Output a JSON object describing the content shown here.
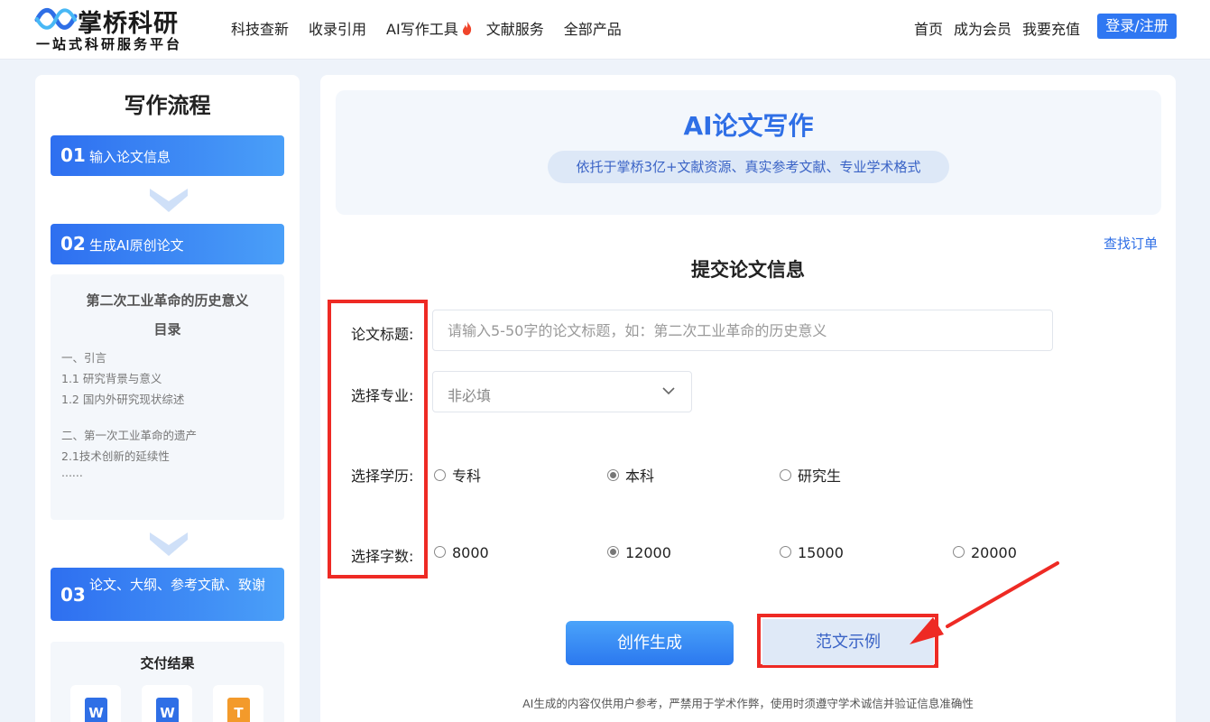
{
  "header": {
    "logo_title": "掌桥科研",
    "logo_subtitle": "一站式科研服务平台",
    "nav": [
      "科技查新",
      "收录引用",
      "AI写作工具",
      "文献服务",
      "全部产品"
    ],
    "right_nav": [
      "首页",
      "成为会员",
      "我要充值"
    ],
    "login_label": "登录/注册"
  },
  "sidebar": {
    "title": "写作流程",
    "steps": [
      {
        "num": "01",
        "label": "输入论文信息"
      },
      {
        "num": "02",
        "label": "生成AI原创论文"
      },
      {
        "num": "03",
        "label": "论文、大纲、参考文献、致谢"
      }
    ],
    "outline": {
      "paper_title": "第二次工业革命的历史意义",
      "toc_label": "目录",
      "lines": [
        "一、引言",
        "1.1 研究背景与意义",
        "1.2 国内外研究现状综述",
        "二、第一次工业革命的遗产",
        "2.1技术创新的延续性",
        "......"
      ]
    },
    "delivery_title": "交付结果",
    "delivery_files": [
      "W",
      "W",
      "T"
    ]
  },
  "main": {
    "banner_title": "AI论文写作",
    "banner_subtitle": "依托于掌桥3亿+文献资源、真实参考文献、专业学术格式",
    "order_link": "查找订单",
    "form_title": "提交论文信息",
    "fields": {
      "title_label": "论文标题:",
      "title_placeholder": "请输入5-50字的论文标题，如：第二次工业革命的历史意义",
      "major_label": "选择专业:",
      "major_value": "非必填",
      "degree_label": "选择学历:",
      "degree_options": [
        "专科",
        "本科",
        "研究生"
      ],
      "degree_selected": "本科",
      "words_label": "选择字数:",
      "words_options": [
        "8000",
        "12000",
        "15000",
        "20000"
      ],
      "words_selected": "12000"
    },
    "generate_label": "创作生成",
    "sample_label": "范文示例",
    "disclaimer": "AI生成的内容仅供用户参考，严禁用于学术作弊，使用时须遵守学术诚信并验证信息准确性"
  },
  "colors": {
    "primary": "#2f6fe6",
    "highlight_red": "#ee2a24",
    "page_bg": "#eef3fa"
  }
}
